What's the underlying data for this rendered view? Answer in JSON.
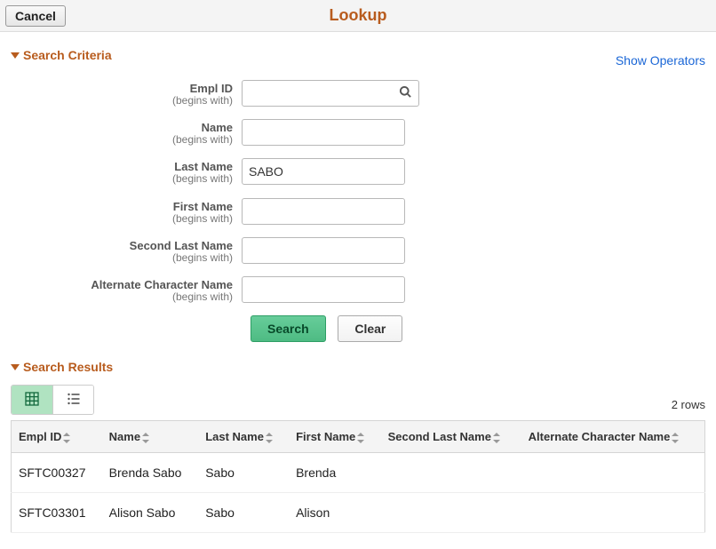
{
  "header": {
    "cancel": "Cancel",
    "title": "Lookup"
  },
  "criteria": {
    "section_title": "Search Criteria",
    "show_operators": "Show Operators",
    "hint": "(begins with)",
    "fields": {
      "empl_id": {
        "label": "Empl ID",
        "value": ""
      },
      "name": {
        "label": "Name",
        "value": ""
      },
      "last_name": {
        "label": "Last Name",
        "value": "SABO"
      },
      "first_name": {
        "label": "First Name",
        "value": ""
      },
      "second_last_name": {
        "label": "Second Last Name",
        "value": ""
      },
      "alt_char_name": {
        "label": "Alternate Character Name",
        "value": ""
      }
    },
    "search_btn": "Search",
    "clear_btn": "Clear"
  },
  "results": {
    "section_title": "Search Results",
    "row_count": "2 rows",
    "columns": {
      "empl_id": "Empl ID",
      "name": "Name",
      "last_name": "Last Name",
      "first_name": "First Name",
      "second_last_name": "Second Last Name",
      "alt_char_name": "Alternate Character Name"
    },
    "rows": [
      {
        "empl_id": "SFTC00327",
        "name": "Brenda Sabo",
        "last_name": "Sabo",
        "first_name": "Brenda",
        "second_last_name": "",
        "alt_char_name": ""
      },
      {
        "empl_id": "SFTC03301",
        "name": "Alison Sabo",
        "last_name": "Sabo",
        "first_name": "Alison",
        "second_last_name": "",
        "alt_char_name": ""
      }
    ]
  }
}
